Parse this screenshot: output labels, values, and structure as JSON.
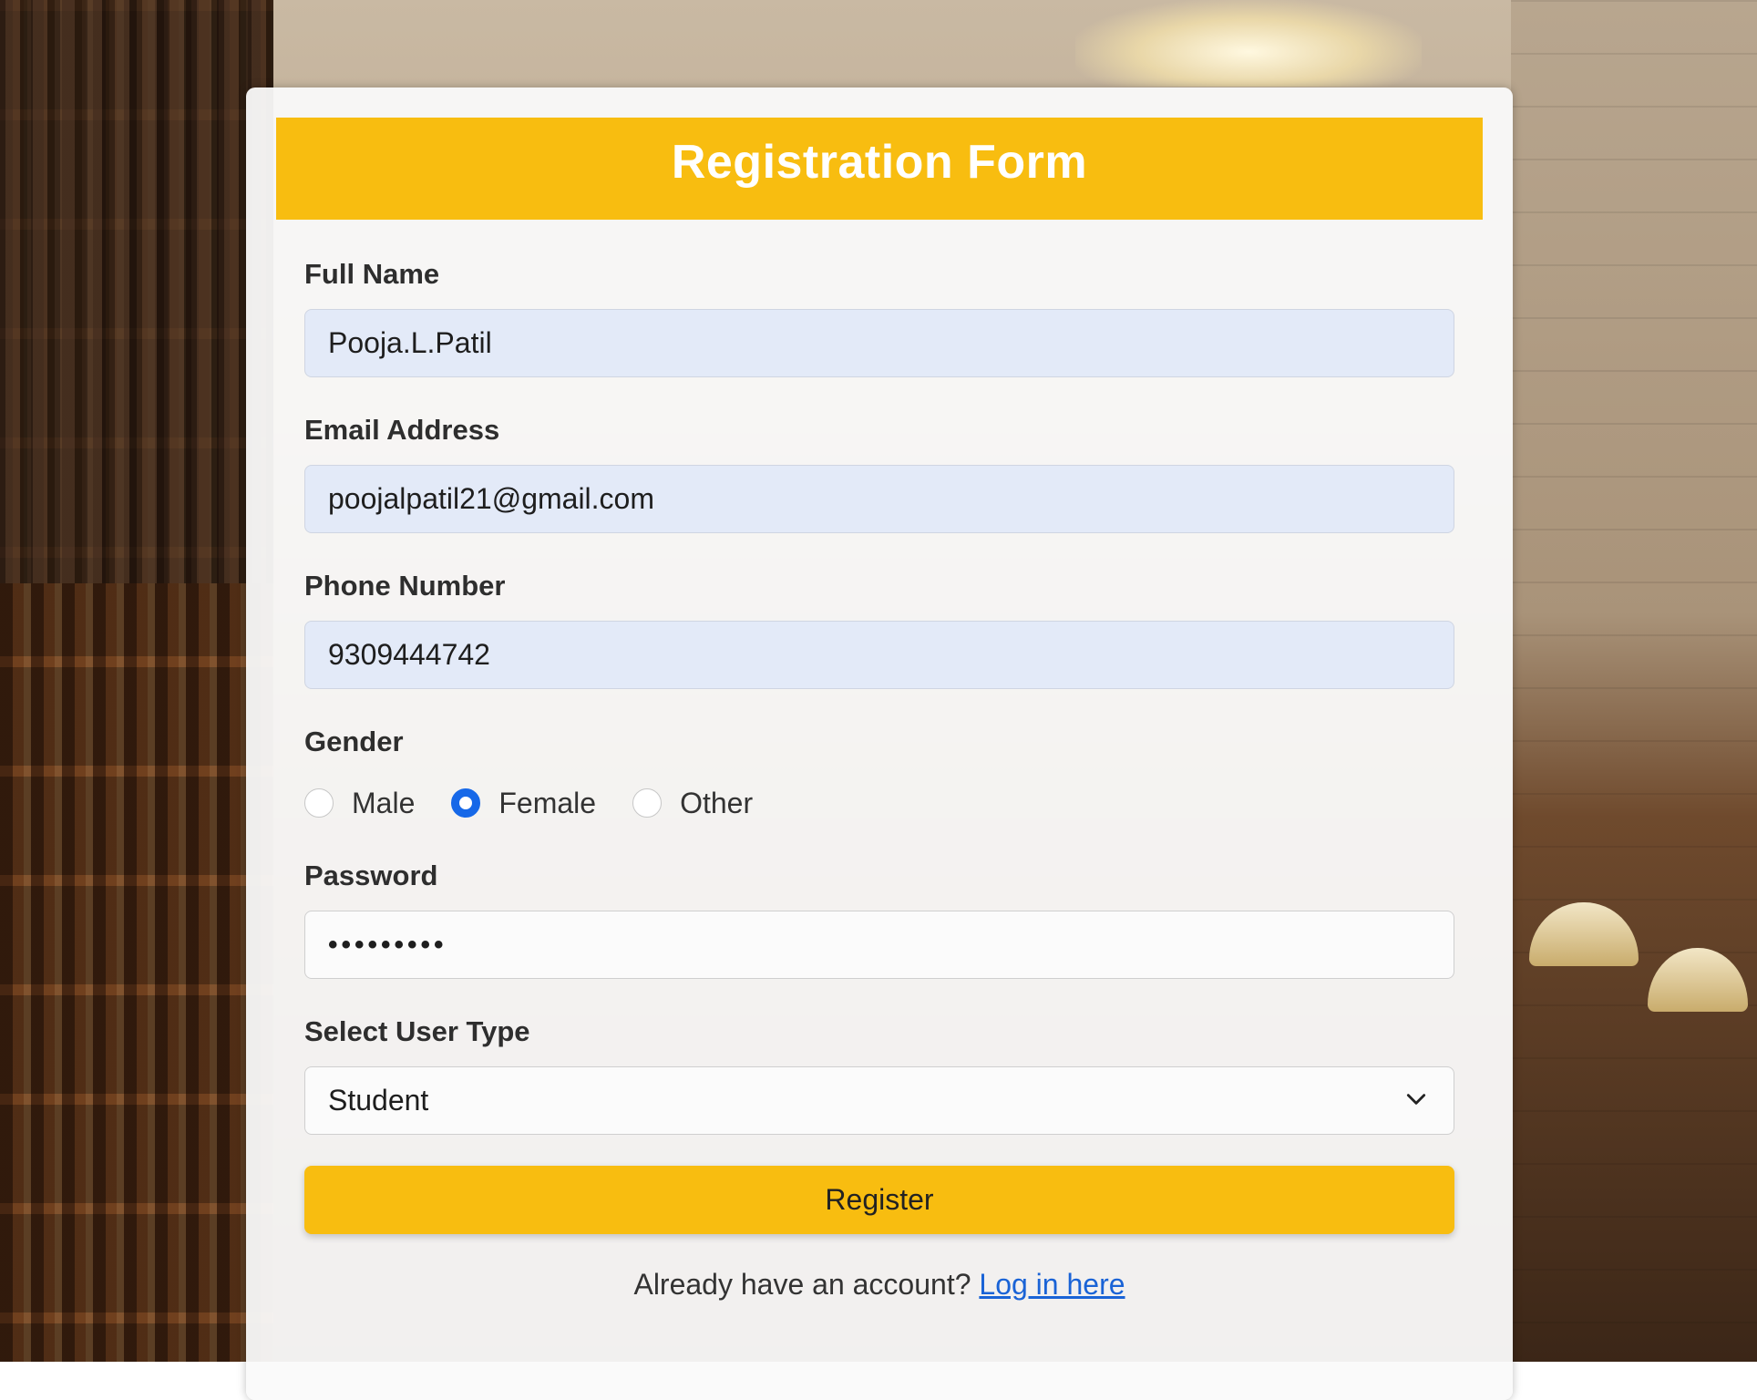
{
  "form": {
    "title": "Registration Form",
    "full_name": {
      "label": "Full Name",
      "value": "Pooja.L.Patil"
    },
    "email": {
      "label": "Email Address",
      "value": "poojalpatil21@gmail.com"
    },
    "phone": {
      "label": "Phone Number",
      "value": "9309444742"
    },
    "gender": {
      "label": "Gender",
      "options": [
        "Male",
        "Female",
        "Other"
      ],
      "selected": "Female"
    },
    "password": {
      "label": "Password",
      "value": "•••••••••"
    },
    "user_type": {
      "label": "Select User Type",
      "value": "Student"
    },
    "register_label": "Register",
    "login_prompt": "Already have an account?",
    "login_link": "Log in here"
  },
  "colors": {
    "accent": "#f8bd10",
    "radio_selected": "#1668e8",
    "link": "#1a63d6",
    "input_filled_bg": "#e3eaf8"
  },
  "icons": [
    "chevron-down-icon"
  ]
}
